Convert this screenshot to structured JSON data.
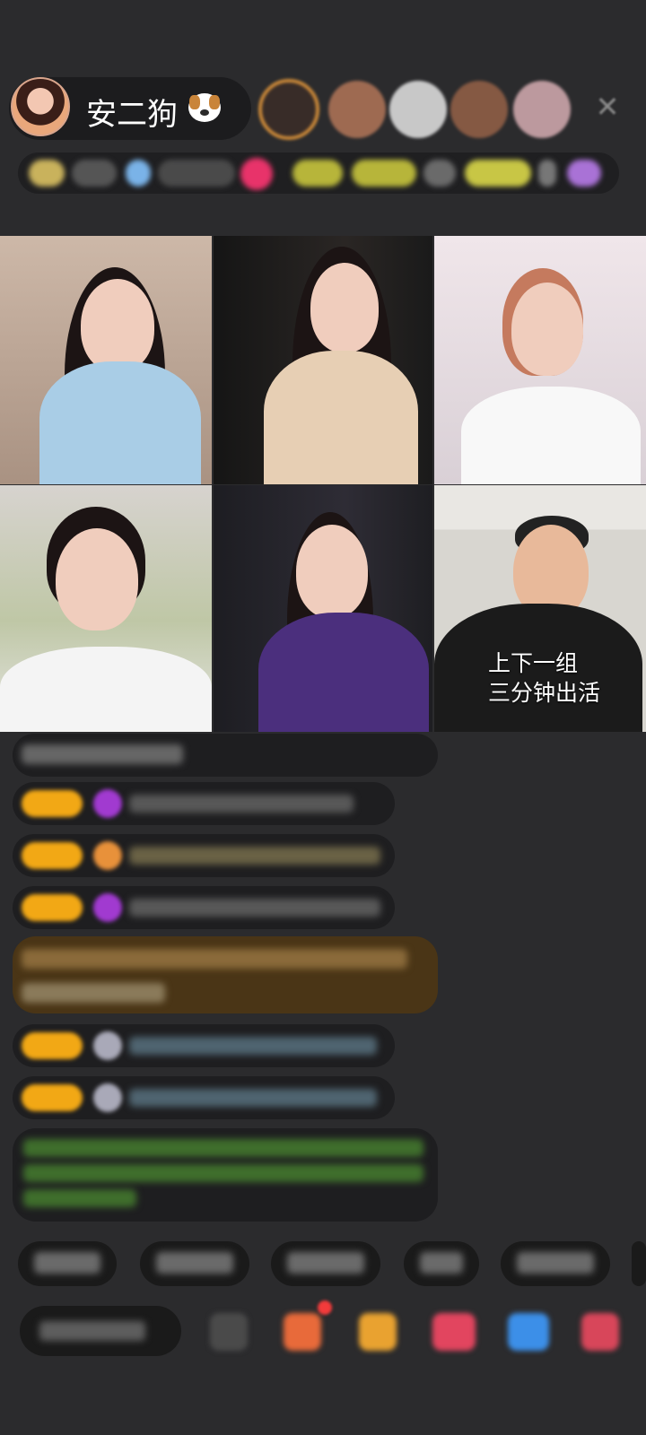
{
  "host": {
    "name": "安二狗"
  },
  "icons": {
    "host_emoji": "dog-face-emoji",
    "close": "close-icon",
    "viewer_colors": [
      "#d9913a",
      "#b7785c",
      "#e6e6e6",
      "#a06a4d",
      "#d8b3b8"
    ]
  },
  "video_grid": {
    "caption": [
      "上下一组",
      "三分钟出活"
    ]
  },
  "colors": {
    "background": "#2b2b2d",
    "badge": "#f2a815",
    "highlight_message": "#4a3516",
    "green_text": "#6cbe45"
  }
}
